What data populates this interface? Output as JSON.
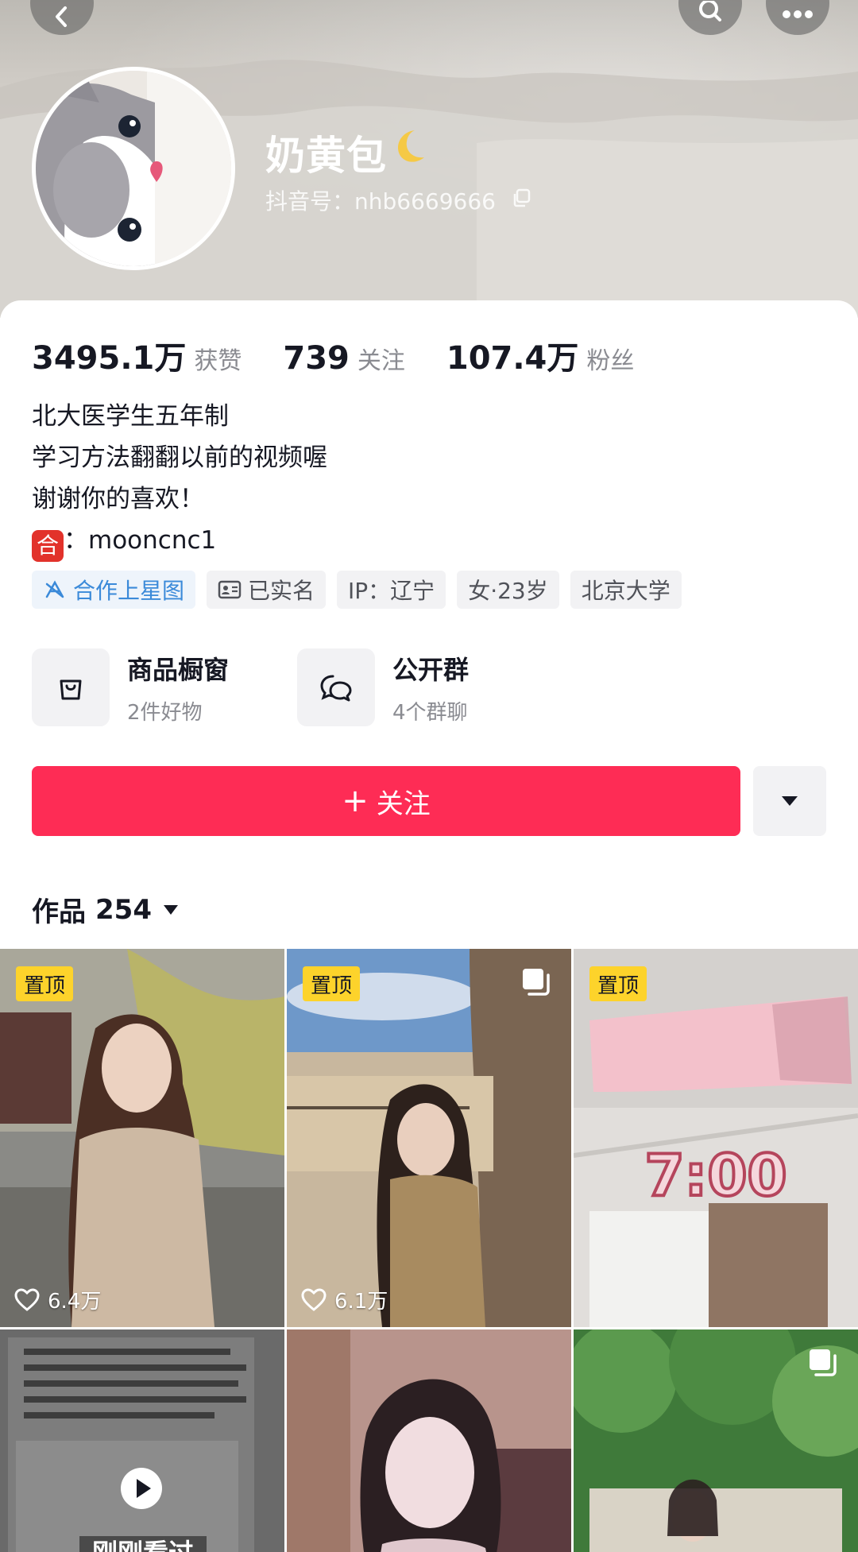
{
  "header": {
    "nickname": "奶黄包",
    "douyin_id": "抖音号：nhb6669666"
  },
  "stats": [
    {
      "value": "3495.1万",
      "label": "获赞"
    },
    {
      "value": "739",
      "label": "关注"
    },
    {
      "value": "107.4万",
      "label": "粉丝"
    }
  ],
  "bio": {
    "lines": [
      "北大医学生五年制",
      "学习方法翻翻以前的视频喔",
      "谢谢你的喜欢！"
    ],
    "badge": "合",
    "contact": "：mooncnc1"
  },
  "tags": [
    {
      "label": "合作上星图",
      "icon": "star-map-icon"
    },
    {
      "label": "已实名",
      "icon": "id-card-icon"
    },
    {
      "label": "IP：辽宁"
    },
    {
      "label": "女·23岁"
    },
    {
      "label": "北京大学"
    }
  ],
  "features": {
    "shop": {
      "title": "商品橱窗",
      "sub": "2件好物",
      "icon": "shopping-bag-icon"
    },
    "group": {
      "title": "公开群",
      "sub": "4个群聊",
      "icon": "chat-group-icon"
    }
  },
  "follow": {
    "plus": "+",
    "label": "关注"
  },
  "works": {
    "label": "作品",
    "count": "254"
  },
  "videos": [
    {
      "pinned": "置顶",
      "likes": "6.4万"
    },
    {
      "pinned": "置顶",
      "likes": "6.1万"
    },
    {
      "pinned": "置顶",
      "overlay_text": "7:00"
    },
    {
      "overlay_text": "刚刚看过"
    },
    {},
    {}
  ],
  "colors": {
    "accent": "#fe2c55",
    "pin_badge": "#fdd32b",
    "tag_blue": "#3b8ad9"
  }
}
